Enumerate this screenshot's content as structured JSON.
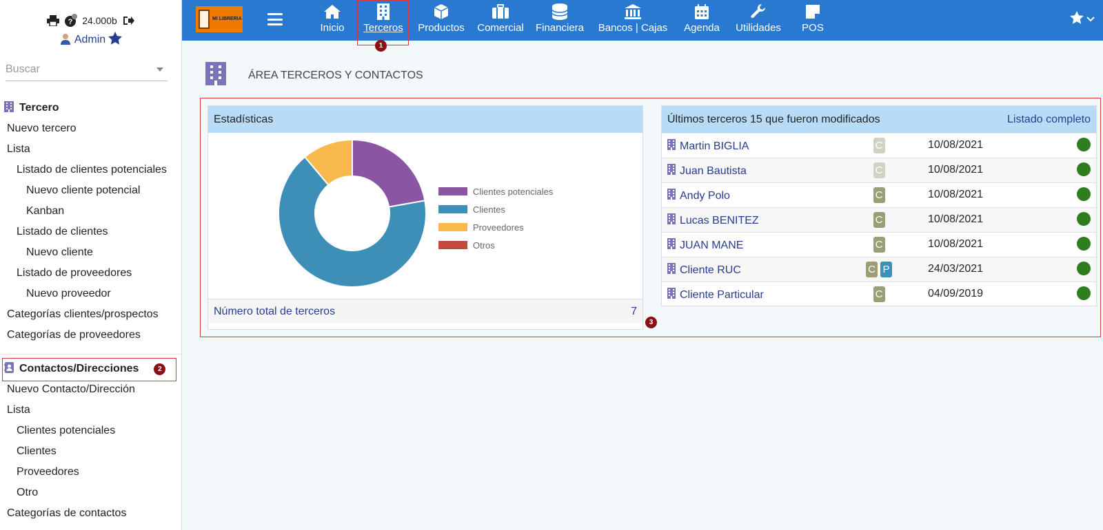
{
  "user": {
    "credit": "24.000b",
    "name": "Admin"
  },
  "search": {
    "placeholder": "Buscar"
  },
  "sidebar": {
    "tercero": {
      "title": "Tercero",
      "items": [
        "Nuevo tercero",
        "Lista",
        "Listado de clientes potenciales",
        "Nuevo cliente potencial",
        "Kanban",
        "Listado de clientes",
        "Nuevo cliente",
        "Listado de proveedores",
        "Nuevo proveedor",
        "Categorías clientes/prospectos",
        "Categorías de proveedores"
      ]
    },
    "contactos": {
      "title": "Contactos/Direcciones",
      "badge": "2",
      "items": [
        "Nuevo Contacto/Dirección",
        "Lista",
        "Clientes potenciales",
        "Clientes",
        "Proveedores",
        "Otro",
        "Categorías de contactos"
      ]
    }
  },
  "topbar": {
    "logo_text": "MI LIBRERIA",
    "nav": [
      "Inicio",
      "Terceros",
      "Productos",
      "Comercial",
      "Financiera",
      "Bancos | Cajas",
      "Agenda",
      "Utilidades",
      "POS"
    ],
    "active_badge": "1"
  },
  "page": {
    "title": "ÁREA TERCEROS Y CONTACTOS",
    "panel_badge": "3"
  },
  "stats": {
    "title": "Estadísticas",
    "total_label": "Número total de terceros",
    "total_value": "7"
  },
  "chart_data": {
    "type": "pie",
    "donut": true,
    "categories": [
      "Clientes potenciales",
      "Clientes",
      "Proveedores",
      "Otros"
    ],
    "values": [
      2,
      6,
      1,
      0
    ],
    "colors": [
      "#8a55a3",
      "#3d8fb8",
      "#f7b94b",
      "#c24a3a"
    ],
    "legend": "right"
  },
  "latest": {
    "title": "Últimos terceros 15 que fueron modificados",
    "link": "Listado completo",
    "rows": [
      {
        "name": "Martin BIGLIA",
        "tags": [
          "C"
        ],
        "muted": true,
        "date": "10/08/2021"
      },
      {
        "name": "Juan Bautista",
        "tags": [
          "C"
        ],
        "muted": true,
        "date": "10/08/2021"
      },
      {
        "name": "Andy Polo",
        "tags": [
          "C"
        ],
        "muted": false,
        "date": "10/08/2021"
      },
      {
        "name": "Lucas BENITEZ",
        "tags": [
          "C"
        ],
        "muted": false,
        "date": "10/08/2021"
      },
      {
        "name": "JUAN MANE",
        "tags": [
          "C"
        ],
        "muted": false,
        "date": "10/08/2021"
      },
      {
        "name": "Cliente RUC",
        "tags": [
          "C",
          "P"
        ],
        "muted": false,
        "date": "24/03/2021"
      },
      {
        "name": "Cliente Particular",
        "tags": [
          "C"
        ],
        "muted": false,
        "date": "04/09/2019"
      }
    ]
  }
}
